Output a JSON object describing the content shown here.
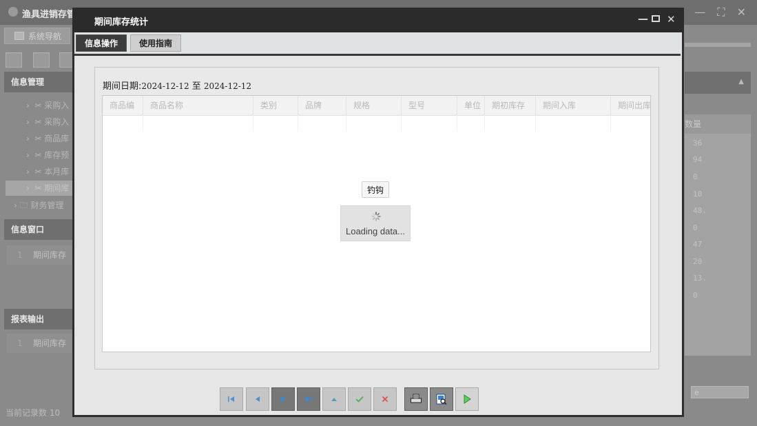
{
  "app": {
    "title": "渔具进销存管",
    "nav_tab": "系统导航",
    "sections": {
      "info_manage": "信息管理",
      "info_window": "信息窗口",
      "report_output": "报表输出"
    },
    "tree_items": [
      "采购入",
      "采购入",
      "商品库",
      "库存预",
      "本月库",
      "期间库"
    ],
    "folder_item": "财务管理",
    "window_items": [
      {
        "num": "1",
        "label": "期间库存"
      }
    ],
    "report_items": [
      {
        "num": "1",
        "label": "期间库存"
      }
    ],
    "status": "当前记录数 10",
    "right_col_header": "数量",
    "right_values": [
      "36",
      "94",
      "0",
      "10",
      "48.",
      "0",
      "47",
      "20",
      "13.",
      "0"
    ],
    "right_input_value": "e"
  },
  "modal": {
    "title": "期间库存统计",
    "controls": {
      "minimize": "—",
      "maximize": "⛶",
      "close": "✕"
    },
    "tabs": {
      "active": "信息操作",
      "inactive": "使用指南"
    },
    "date_label": "期间日期:",
    "date_from": "2024-12-12",
    "date_sep": "至",
    "date_to": "2024-12-12",
    "grid_headers": [
      "商品编",
      "商品名称",
      "类别",
      "品牌",
      "规格",
      "型号",
      "单位",
      "期初库存",
      "期间入库",
      "期间出库"
    ],
    "mask_label": "钓钩",
    "loading_text": "Loading data..."
  },
  "pager": {
    "buttons": [
      "first-page",
      "prev-page",
      "next-page",
      "last-page",
      "up",
      "confirm",
      "cancel",
      "print",
      "preview",
      "run"
    ]
  }
}
